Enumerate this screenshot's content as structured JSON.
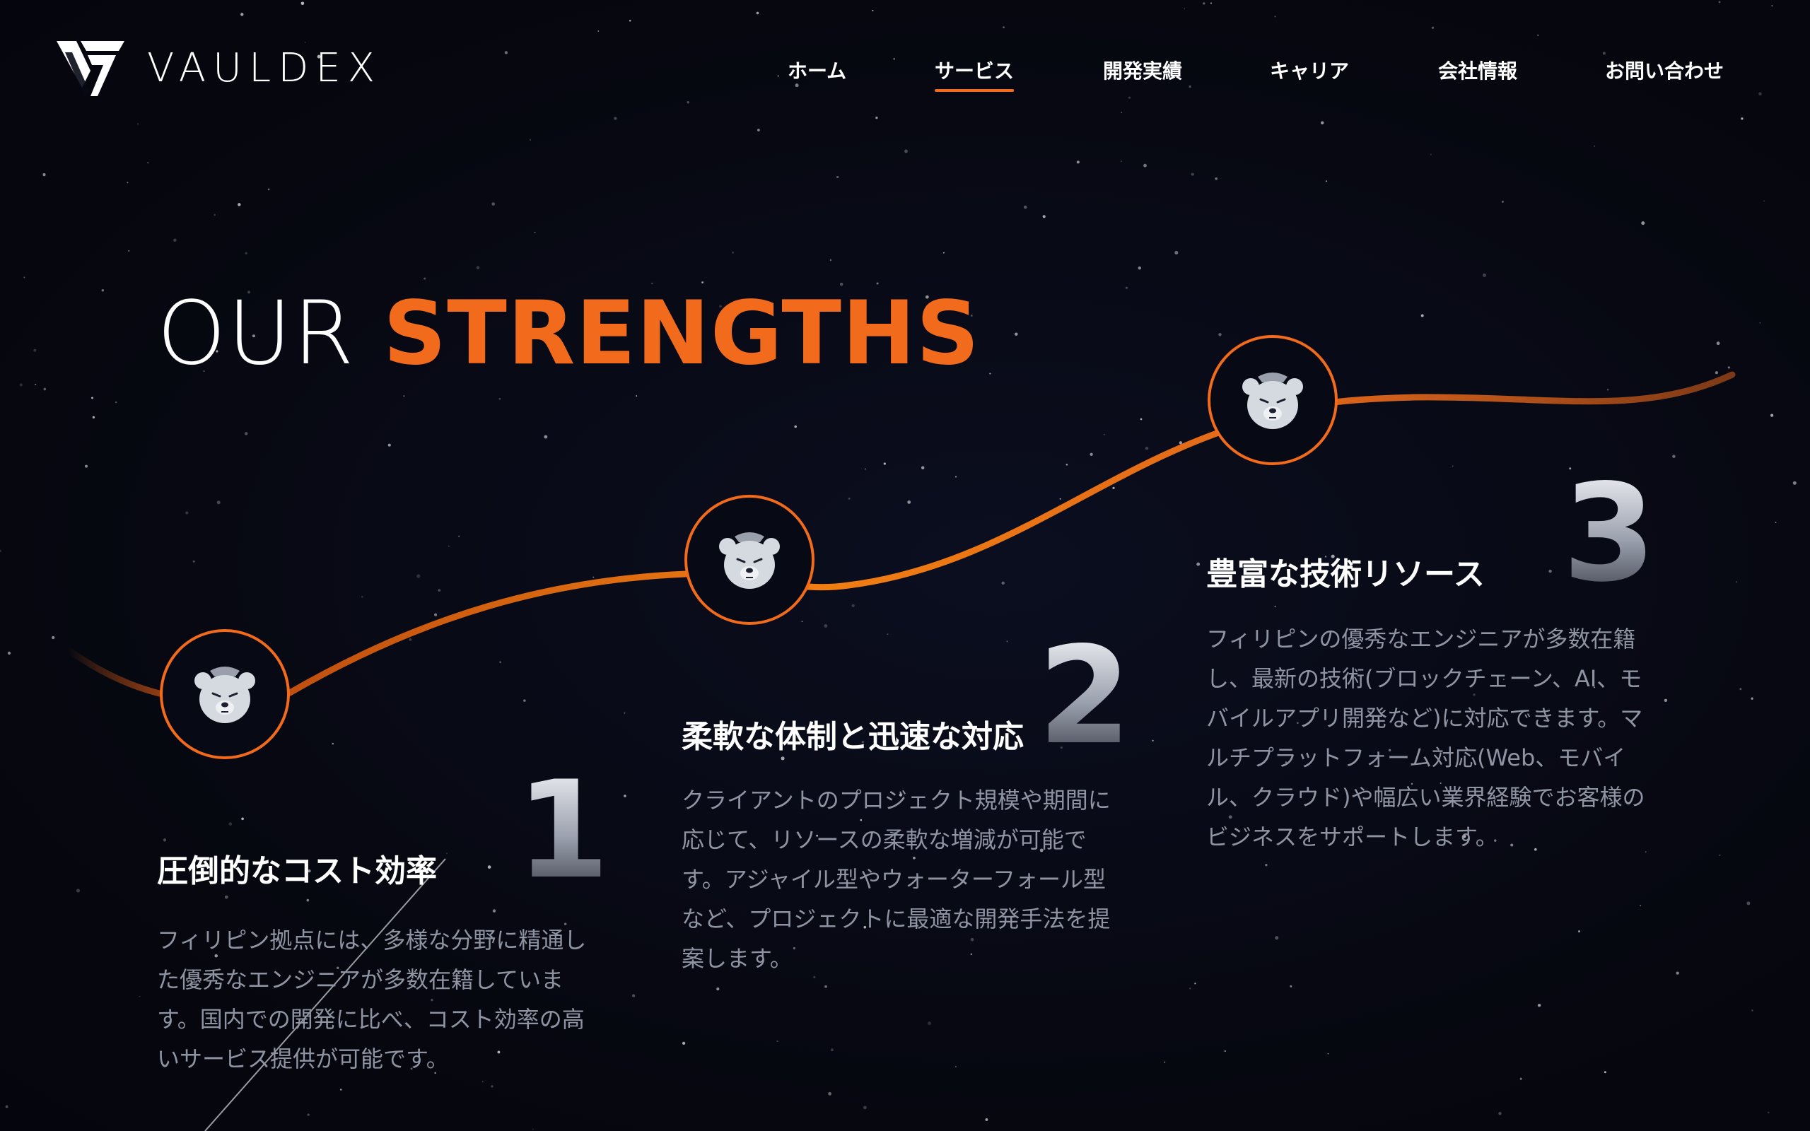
{
  "brand": {
    "name": "VAULDEX"
  },
  "nav": {
    "items": [
      {
        "label": "ホーム",
        "active": false
      },
      {
        "label": "サービス",
        "active": true
      },
      {
        "label": "開発実績",
        "active": false
      },
      {
        "label": "キャリア",
        "active": false
      },
      {
        "label": "会社情報",
        "active": false
      },
      {
        "label": "お問い合わせ",
        "active": false
      }
    ]
  },
  "headline": {
    "white": "OUR",
    "accent": "STRENGTHS"
  },
  "strengths": [
    {
      "number": "1",
      "title": "圧倒的なコスト効率",
      "body": "フィリピン拠点には、多様な分野に精通した優秀なエンジニアが多数在籍しています。国内での開発に比べ、コスト効率の高いサービス提供が可能です。"
    },
    {
      "number": "2",
      "title": "柔軟な体制と迅速な対応",
      "body": "クライアントのプロジェクト規模や期間に応じて、リソースの柔軟な増減が可能です。アジャイル型やウォーターフォール型など、プロジェクトに最適な開発手法を提案します。"
    },
    {
      "number": "3",
      "title": "豊富な技術リソース",
      "body": "フィリピンの優秀なエンジニアが多数在籍し、最新の技術(ブロックチェーン、AI、モバイルアプリ開発など)に対応できます。マルチプラットフォーム対応(Web、モバイル、クラウド)や幅広い業界経験でお客様のビジネスをサポートします。"
    }
  ],
  "colors": {
    "accent": "#f26a1b",
    "background": "#070914",
    "body_text": "#8f94a3"
  },
  "icons": {
    "badge": "bear-icon",
    "logo": "vauldex-logo-mark"
  }
}
